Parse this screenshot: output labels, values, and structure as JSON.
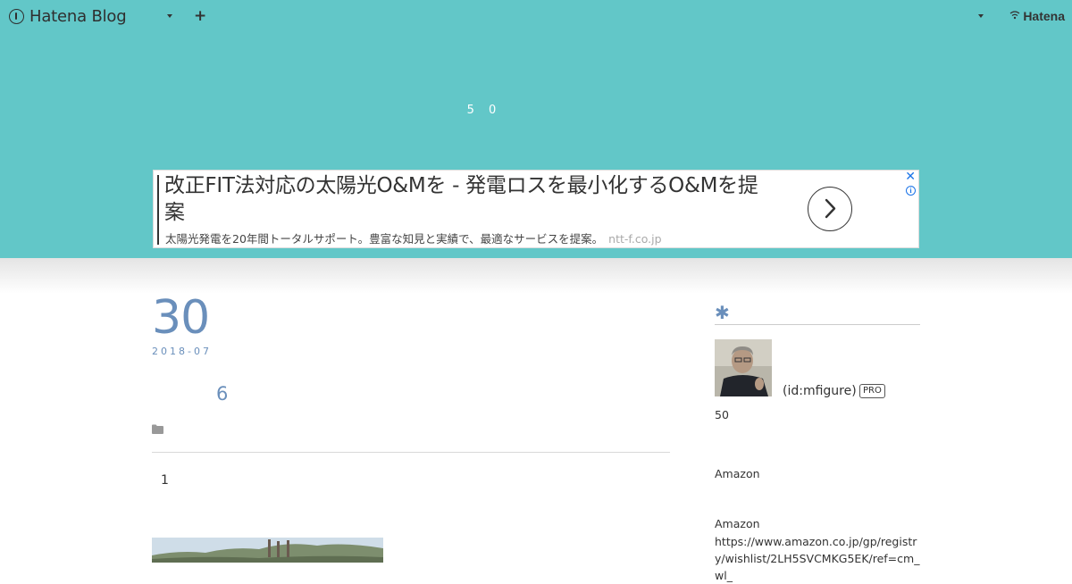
{
  "globalbar": {
    "logo_text": "Hatena Blog",
    "plus_label": "+",
    "right_brand": "Hatena"
  },
  "blog": {
    "title": "5 0"
  },
  "ad": {
    "headline": "改正FIT法対応の太陽光O&Mを - 発電ロスを最小化するO&Mを提案",
    "description": "太陽光発電を20年間トータルサポート。豊富な知見と実績で、最適なサービスを提案。",
    "domain": "ntt-f.co.jp",
    "close_glyph": "✕",
    "info_glyph": "i"
  },
  "entry": {
    "day": "30",
    "year_month": "2018-07",
    "title": "6",
    "body_text": "1"
  },
  "sidebar": {
    "heading_mark": "✱",
    "user_id": "(id:mfigure)",
    "pro_badge": "PRO",
    "text_1": "50",
    "text_2": "Amazon",
    "text_3": "Amazon",
    "url": "https://www.amazon.co.jp/gp/registry/wishlist/2LH5SVCMKG5EK/ref=cm_wl_"
  },
  "colors": {
    "header": "#62c7c8",
    "accent": "#6a8fbb",
    "ad_icon": "#1a73e8"
  },
  "icons": {
    "logo": "hatena-blog-logo-icon",
    "dropdown": "chevron-down-icon",
    "ad_arrow": "chevron-right-icon",
    "category": "folder-icon"
  }
}
